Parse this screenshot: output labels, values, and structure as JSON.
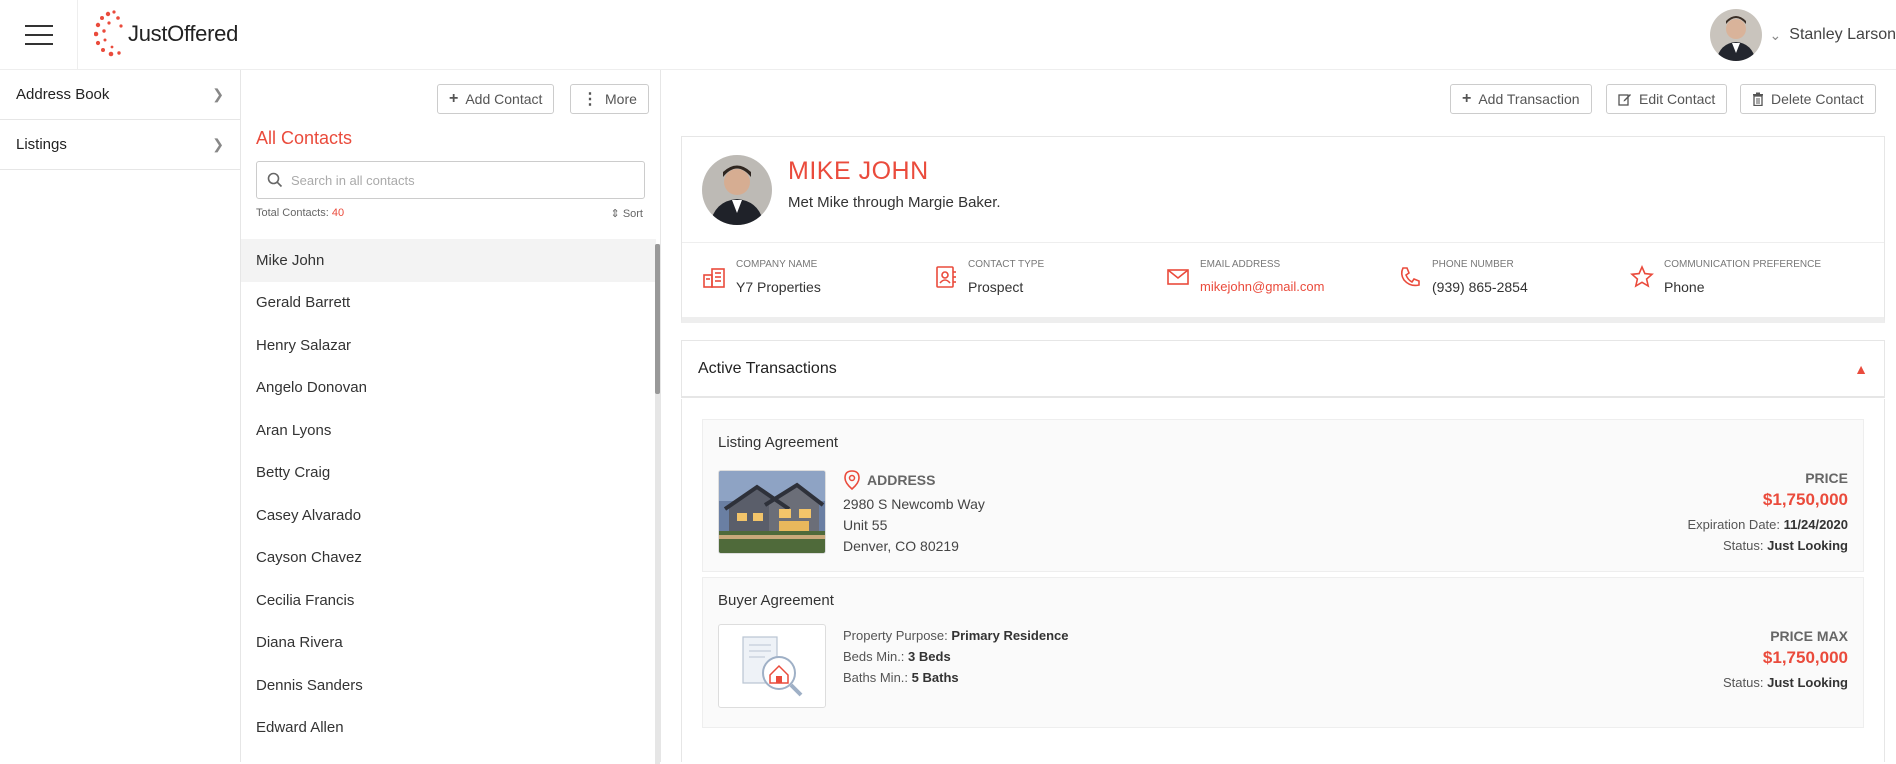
{
  "app": {
    "brand": "JustOffered",
    "accent": "#ea4b3c"
  },
  "user": {
    "name": "Stanley Larson"
  },
  "nav": {
    "items": [
      {
        "label": "Address Book"
      },
      {
        "label": "Listings"
      }
    ]
  },
  "contacts_panel": {
    "add_label": "Add Contact",
    "more_label": "More",
    "heading": "All Contacts",
    "search_placeholder": "Search in all contacts",
    "total_label": "Total Contacts:",
    "total_count": "40",
    "sort_label": "Sort",
    "items": [
      "Mike John",
      "Gerald Barrett",
      "Henry Salazar",
      "Angelo Donovan",
      "Aran Lyons",
      "Betty Craig",
      "Casey Alvarado",
      "Cayson Chavez",
      "Cecilia Francis",
      "Diana Rivera",
      "Dennis Sanders",
      "Edward Allen"
    ]
  },
  "detail": {
    "add_tx_label": "Add Transaction",
    "edit_label": "Edit Contact",
    "delete_label": "Delete Contact",
    "name": "MIKE JOHN",
    "note": "Met Mike through Margie Baker.",
    "facts": [
      {
        "label": "COMPANY NAME",
        "value": "Y7 Properties"
      },
      {
        "label": "CONTACT TYPE",
        "value": "Prospect"
      },
      {
        "label": "EMAIL ADDRESS",
        "value": "mikejohn@gmail.com"
      },
      {
        "label": "PHONE NUMBER",
        "value": "(939) 865-2854"
      },
      {
        "label": "COMMUNICATION PREFERENCE",
        "value": "Phone"
      }
    ],
    "active_title": "Active Transactions",
    "listing": {
      "title": "Listing Agreement",
      "address_heading": "ADDRESS",
      "line1": "2980 S Newcomb Way",
      "line2": "Unit 55",
      "line3": "Denver, CO 80219",
      "price_heading": "PRICE",
      "price": "$1,750,000",
      "exp_label": "Expiration Date:",
      "exp_value": "11/24/2020",
      "status_label": "Status:",
      "status_value": "Just Looking"
    },
    "buyer": {
      "title": "Buyer Agreement",
      "purpose_label": "Property Purpose:",
      "purpose_value": "Primary Residence",
      "beds_label": "Beds Min.:",
      "beds_value": "3 Beds",
      "baths_label": "Baths Min.:",
      "baths_value": "5 Baths",
      "price_heading": "PRICE MAX",
      "price": "$1,750,000",
      "status_label": "Status:",
      "status_value": "Just Looking"
    }
  }
}
